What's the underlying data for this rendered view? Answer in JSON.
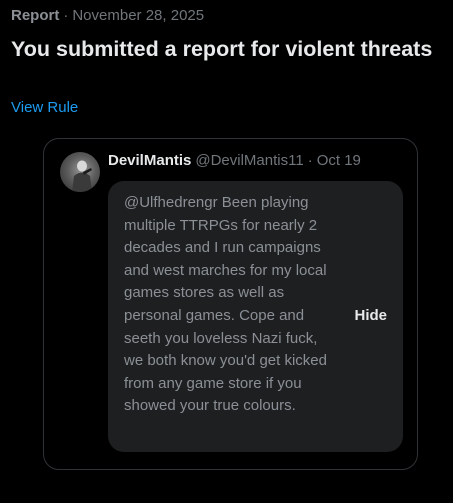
{
  "report": {
    "type_label": "Report",
    "separator": "·",
    "date": "November 28, 2025",
    "title": "You submitted a report for violent threats",
    "view_rule_label": "View Rule"
  },
  "post": {
    "author_name": "DevilMantis",
    "author_handle": "@DevilMantis11",
    "separator": "·",
    "date": "Oct 19",
    "text": "@Ulfhedrengr Been playing multiple TTRPGs for nearly 2 decades and I run campaigns and west marches for my local games stores as well as personal games. Cope and seeth you loveless Nazi fuck, we both know you'd get kicked from any game store if you showed your true colours.",
    "hide_label": "Hide"
  },
  "colors": {
    "background": "#000000",
    "primary_text": "#e7e9ea",
    "secondary_text": "#71767b",
    "link": "#1d9bf0",
    "card_border": "#2f3336",
    "hidden_box": "#1e1f21"
  }
}
